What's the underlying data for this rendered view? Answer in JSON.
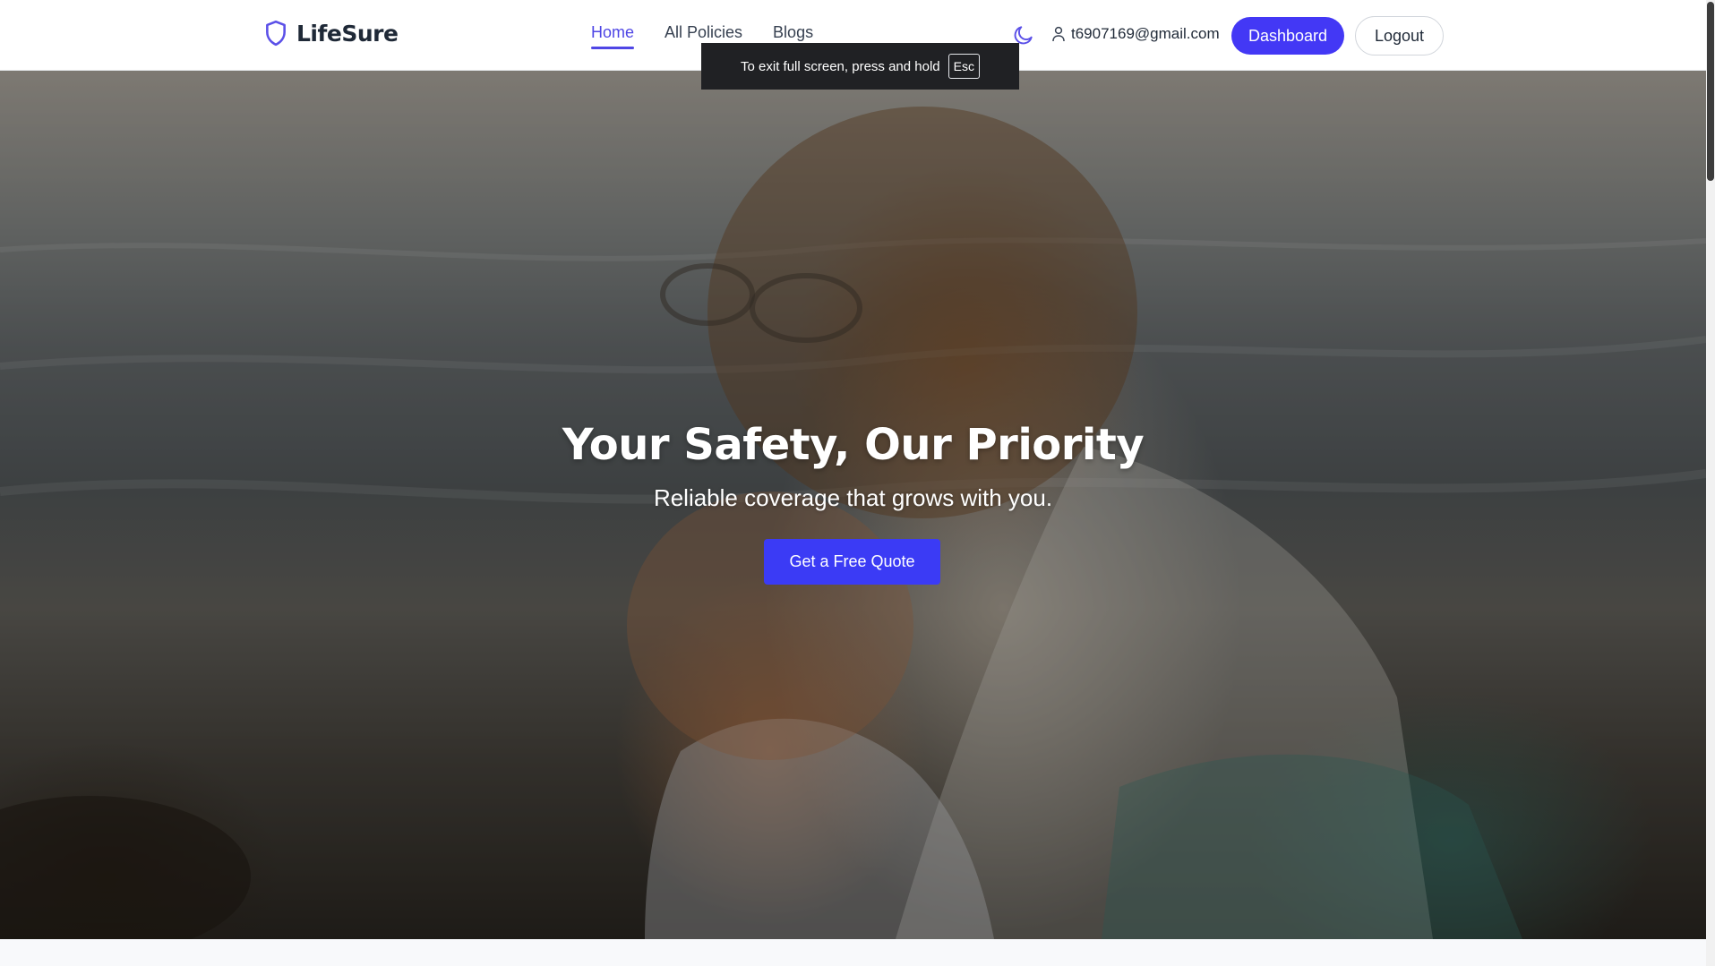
{
  "brand": {
    "name": "LifeSure",
    "icon": "shield-icon"
  },
  "nav": {
    "items": [
      {
        "label": "Home",
        "active": true
      },
      {
        "label": "All Policies",
        "active": false
      },
      {
        "label": "Blogs",
        "active": false
      }
    ]
  },
  "header": {
    "theme_icon": "moon-icon",
    "user_icon": "user-icon",
    "user_email": "t6907169@gmail.com",
    "dashboard_label": "Dashboard",
    "logout_label": "Logout"
  },
  "fullscreen_notice": {
    "text": "To exit full screen, press and hold",
    "key": "Esc"
  },
  "hero": {
    "title": "Your Safety, Our Priority",
    "subtitle": "Reliable coverage that grows with you.",
    "cta_label": "Get a Free Quote"
  },
  "colors": {
    "accent": "#4f46e5",
    "button_primary": "#4338f5",
    "cta": "#3b3bf5"
  }
}
